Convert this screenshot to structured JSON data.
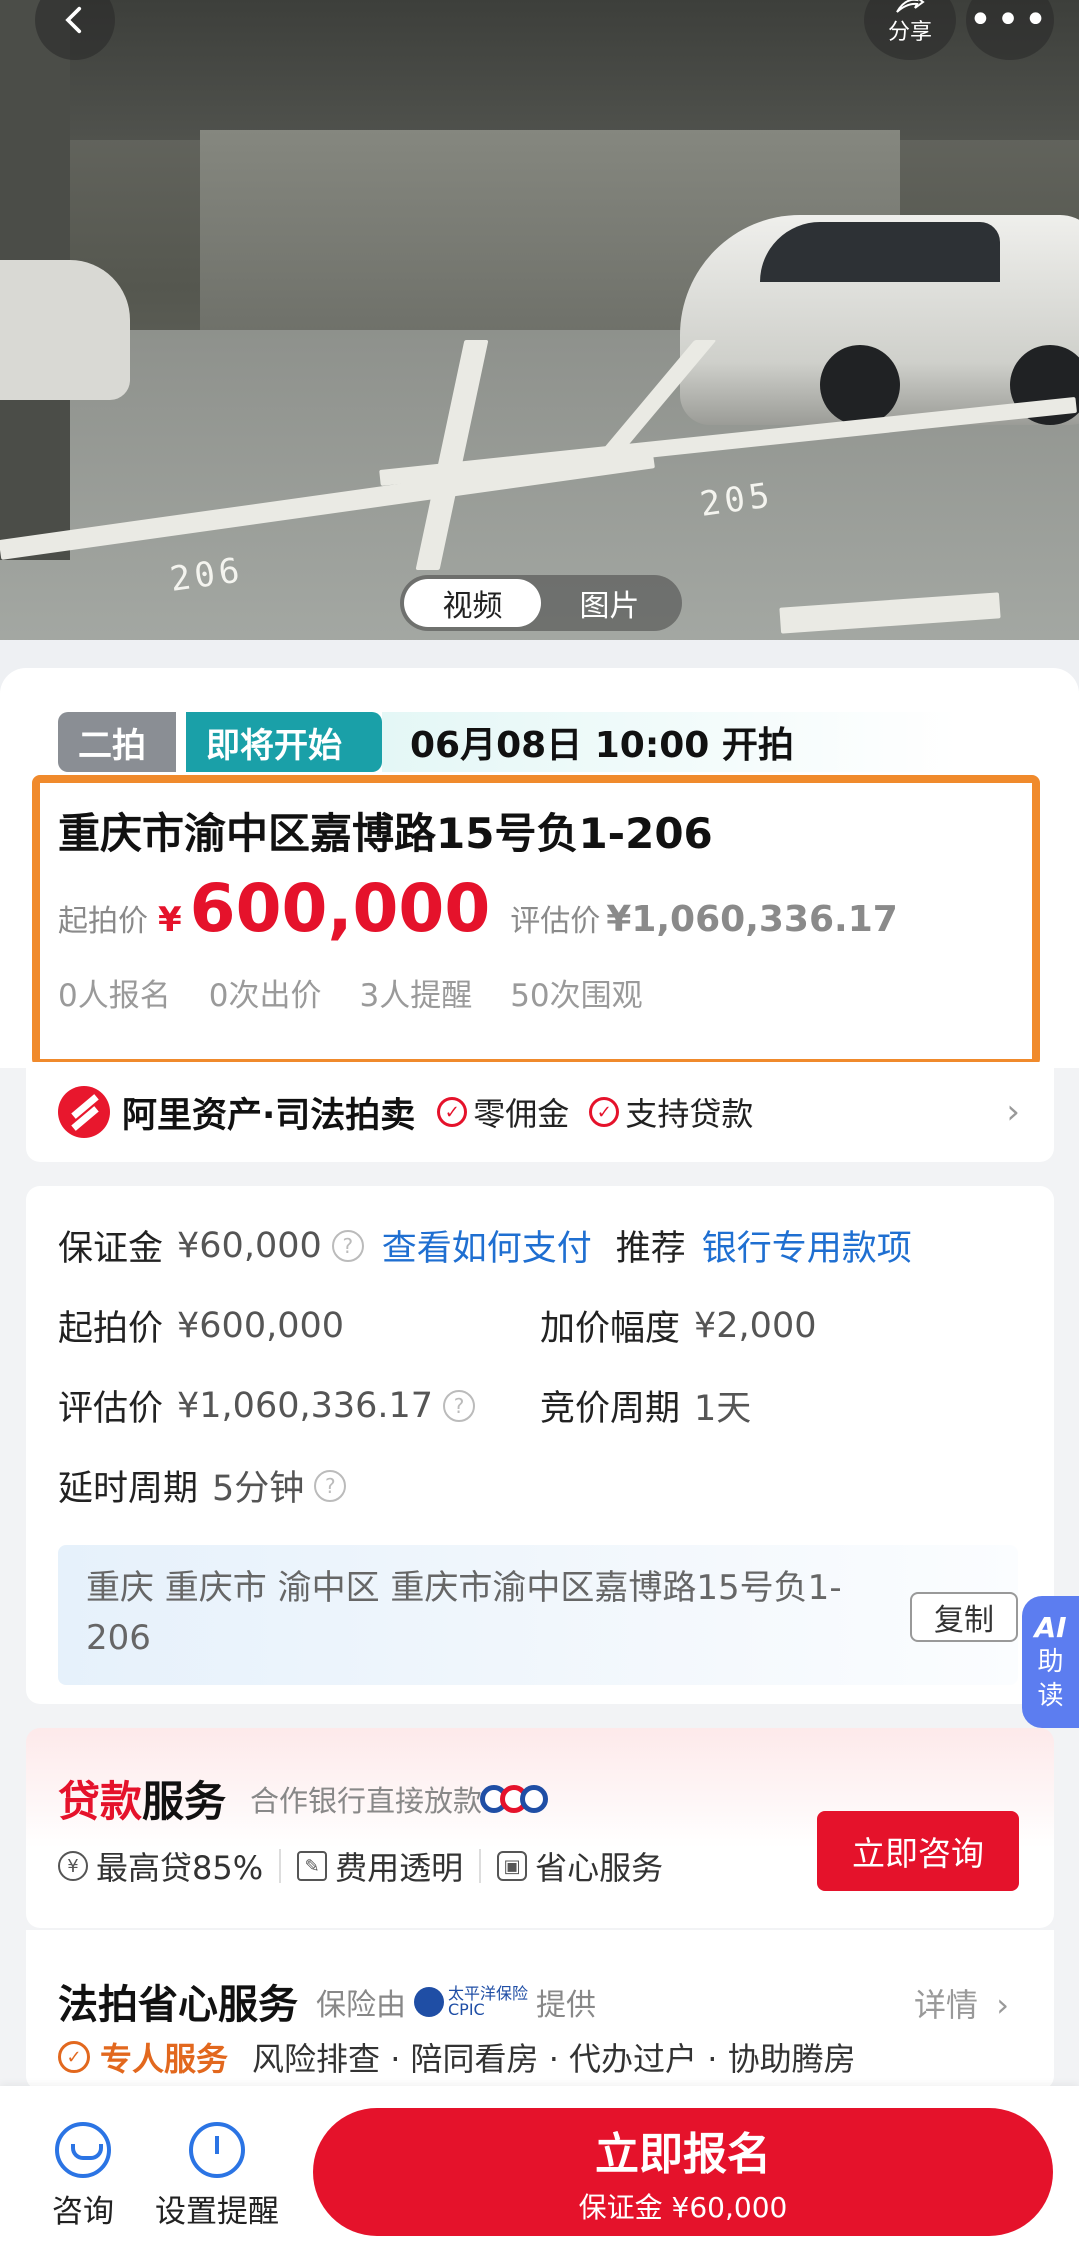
{
  "media": {
    "tabs": [
      "视频",
      "图片"
    ],
    "active": 0,
    "share_label": "分享",
    "more_label": "•••",
    "spot_numbers": [
      "206",
      "205"
    ]
  },
  "auction": {
    "round_tag": "二拍",
    "status_tag": "即将开始",
    "start_time": "06月08日 10:00 开拍",
    "title": "重庆市渝中区嘉博路15号负1-206",
    "start_price_label": "起拍价",
    "currency": "¥",
    "start_price": "600,000",
    "eval_label": "评估价",
    "eval_price": "¥1,060,336.17",
    "stats": [
      "0人报名",
      "0次出价",
      "3人提醒",
      "50次围观"
    ]
  },
  "platform": {
    "name": "阿里资产·司法拍卖",
    "features": [
      "零佣金",
      "支持贷款"
    ]
  },
  "details": {
    "deposit_label": "保证金",
    "deposit_value": "¥60,000",
    "how_to_pay": "查看如何支付",
    "recommend_label": "推荐",
    "bank_account": "银行专用款项",
    "start_price_label": "起拍价",
    "start_price_value": "¥600,000",
    "increment_label": "加价幅度",
    "increment_value": "¥2,000",
    "eval_label": "评估价",
    "eval_value": "¥1,060,336.17",
    "cycle_label": "竞价周期",
    "cycle_value": "1天",
    "delay_label": "延时周期",
    "delay_value": "5分钟",
    "address": "重庆 重庆市 渝中区 重庆市渝中区嘉博路15号负1-206",
    "copy_label": "复制"
  },
  "ai_tab": {
    "ai": "AI",
    "label_1": "助",
    "label_2": "读"
  },
  "loan": {
    "title_red": "贷款",
    "title_rest": "服务",
    "subtitle": "合作银行直接放款",
    "features": [
      "最高贷85%",
      "费用透明",
      "省心服务"
    ],
    "consult_label": "立即咨询"
  },
  "service": {
    "title": "法拍省心服务",
    "provided_by": "保险由",
    "insurer": "太平洋保险",
    "insurer_en": "CPIC",
    "provided_suffix": "提供",
    "detail_label": "详情",
    "main_item": "专人服务",
    "items": "风险排查 · 陪同看房 · 代办过户 · 协助腾房"
  },
  "bottom": {
    "consult_label": "咨询",
    "reminder_label": "设置提醒",
    "signup_label": "立即报名",
    "signup_sub": "保证金 ¥60,000"
  },
  "colors": {
    "accent_red": "#e5122b",
    "teal": "#1aa0a8",
    "highlight_orange": "#f08a2c",
    "link_blue": "#1f6fd1"
  }
}
